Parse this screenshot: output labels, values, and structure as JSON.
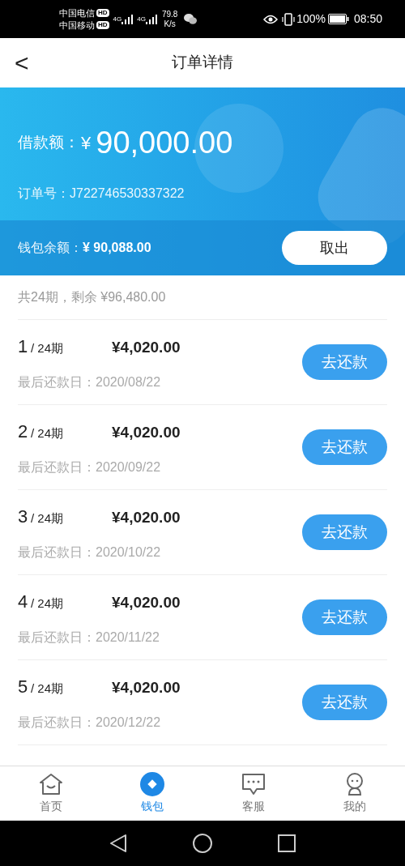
{
  "status_bar": {
    "carriers": [
      {
        "name": "中国电信",
        "badge": "HD"
      },
      {
        "name": "中国移动",
        "badge": "HD"
      }
    ],
    "network": [
      "4G",
      "4G"
    ],
    "speed": "79.8",
    "speed_unit": "K/s",
    "battery": "100%",
    "time": "08:50"
  },
  "header": {
    "back": "<",
    "title": "订单详情"
  },
  "loan": {
    "label": "借款额：",
    "currency": "¥",
    "amount": "90,000.00",
    "order_label": "订单号：",
    "order_no": "J722746530337322"
  },
  "wallet": {
    "label": "钱包余额：",
    "amount": "¥ 90,088.00",
    "button": "取出"
  },
  "summary": "共24期，剩余 ¥96,480.00",
  "installments": [
    {
      "period": "1",
      "total": "/ 24期",
      "amount": "¥4,020.00",
      "due": "最后还款日：2020/08/22",
      "button": "去还款"
    },
    {
      "period": "2",
      "total": "/ 24期",
      "amount": "¥4,020.00",
      "due": "最后还款日：2020/09/22",
      "button": "去还款"
    },
    {
      "period": "3",
      "total": "/ 24期",
      "amount": "¥4,020.00",
      "due": "最后还款日：2020/10/22",
      "button": "去还款"
    },
    {
      "period": "4",
      "total": "/ 24期",
      "amount": "¥4,020.00",
      "due": "最后还款日：2020/11/22",
      "button": "去还款"
    },
    {
      "period": "5",
      "total": "/ 24期",
      "amount": "¥4,020.00",
      "due": "最后还款日：2020/12/22",
      "button": "去还款"
    }
  ],
  "tabs": [
    {
      "label": "首页",
      "kind": "home",
      "selected": false
    },
    {
      "label": "钱包",
      "kind": "wallet",
      "selected": true
    },
    {
      "label": "客服",
      "kind": "chat",
      "selected": false
    },
    {
      "label": "我的",
      "kind": "profile",
      "selected": false
    }
  ]
}
